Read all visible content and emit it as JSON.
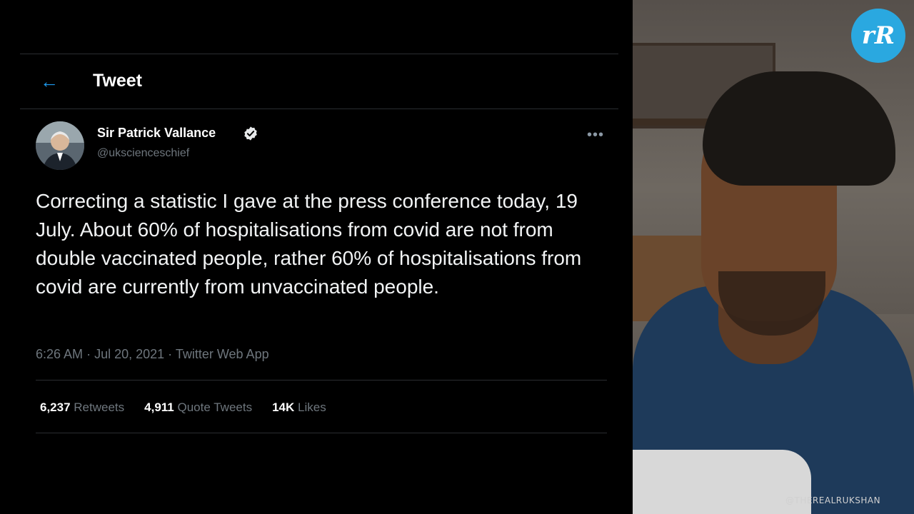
{
  "header": {
    "title": "Tweet",
    "back_icon": "arrow-left-icon",
    "accent": "#1d9bf0"
  },
  "author": {
    "display_name": "Sir Patrick Vallance",
    "handle": "@ukscienceschief",
    "verified_icon": "verified-badge-icon",
    "more_icon": "more-horizontal-icon"
  },
  "tweet": {
    "text": "Correcting a statistic I gave at the press conference today, 19 July. About 60% of hospitalisations from covid are not from double vaccinated people, rather 60% of hospitalisations from covid are currently from unvaccinated people.",
    "time": "6:26 AM",
    "date": "Jul 20, 2021",
    "source": "Twitter Web App",
    "separator": "·"
  },
  "stats": [
    {
      "count": "6,237",
      "label": "Retweets"
    },
    {
      "count": "4,911",
      "label": "Quote Tweets"
    },
    {
      "count": "14K",
      "label": "Likes"
    }
  ],
  "overlay": {
    "logo_text": "rR",
    "watermark": "@THEREALRUKSHAN"
  }
}
